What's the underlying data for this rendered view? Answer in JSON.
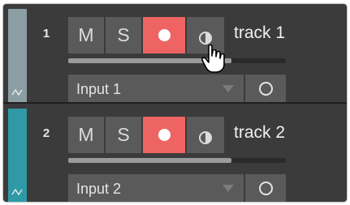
{
  "colors": {
    "record_active": "#ee6462",
    "track1_strip": "#8a9ea3",
    "track2_strip": "#2f9aa6",
    "button": "#5a5a5a",
    "panel": "#3b3b3b"
  },
  "tracks": [
    {
      "number": "1",
      "mute_label": "M",
      "solo_label": "S",
      "name": "track 1",
      "input": "Input 1",
      "record_armed": true,
      "volume_level": 0.75,
      "icons": {
        "strip": "waveform-icon",
        "record": "record-dot-icon",
        "monitor": "monitor-icon",
        "input_arrow": "dropdown-arrow-icon",
        "extra": "circle-icon"
      }
    },
    {
      "number": "2",
      "mute_label": "M",
      "solo_label": "S",
      "name": "track 2",
      "input": "Input 2",
      "record_armed": true,
      "volume_level": 0.75,
      "icons": {
        "strip": "waveform-icon",
        "record": "record-dot-icon",
        "monitor": "monitor-icon",
        "input_arrow": "dropdown-arrow-icon",
        "extra": "circle-icon"
      }
    }
  ],
  "cursor": "hand-pointer-icon"
}
